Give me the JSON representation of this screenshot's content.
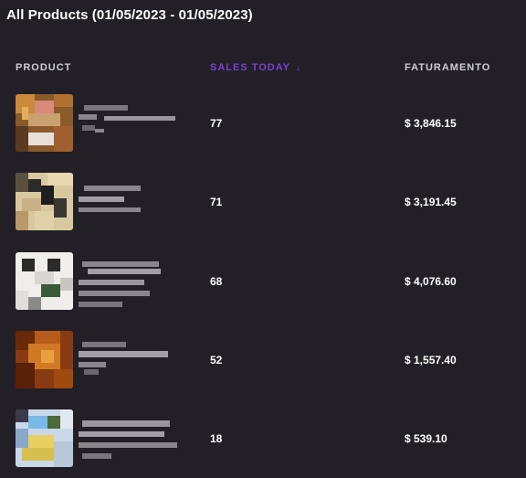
{
  "header": {
    "title": "All Products (01/05/2023 - 01/05/2023)"
  },
  "table": {
    "columns": {
      "product": "PRODUCT",
      "sales_today": "SALES TODAY",
      "revenue": "FATURAMENTO"
    },
    "sort_icon": "arrow-down-icon",
    "rows": [
      {
        "sales": "77",
        "revenue": "$ 3,846.15"
      },
      {
        "sales": "71",
        "revenue": "$ 3,191.45"
      },
      {
        "sales": "68",
        "revenue": "$ 4,076.60"
      },
      {
        "sales": "52",
        "revenue": "$ 1,557.40"
      },
      {
        "sales": "18",
        "revenue": "$ 539.10"
      }
    ]
  },
  "colors": {
    "background": "#222026",
    "accent": "#7b3fd0",
    "text": "#ffffff",
    "muted": "#cfcbd6"
  }
}
